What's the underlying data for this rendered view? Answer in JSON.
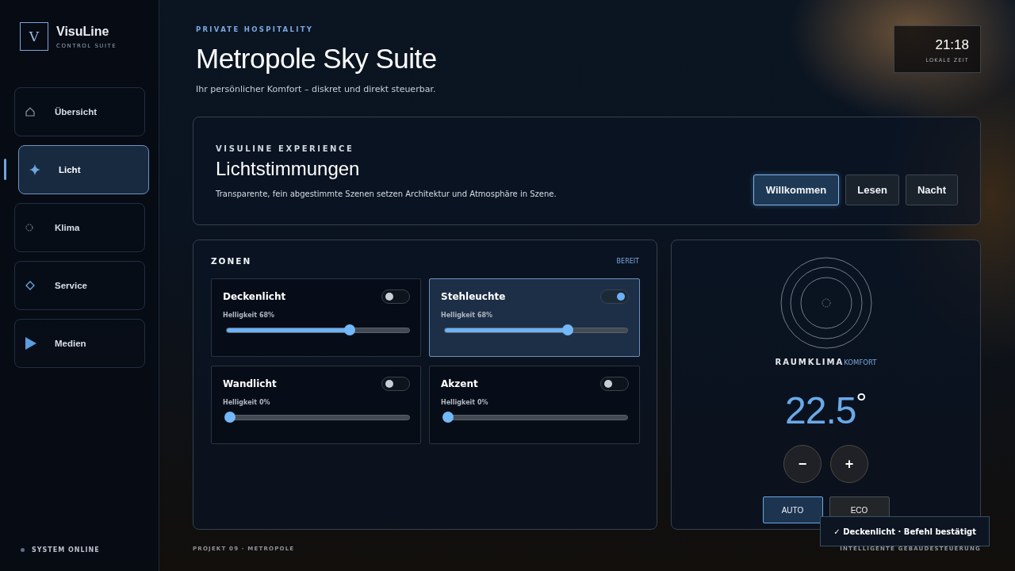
{
  "brand": {
    "mark": "V",
    "name": "VisuLine",
    "tagline": "CONTROL SUITE"
  },
  "sidebar": {
    "items": [
      {
        "label": "Übersicht",
        "selected": false
      },
      {
        "label": "Licht",
        "selected": true
      },
      {
        "label": "Klima",
        "selected": false
      },
      {
        "label": "Service",
        "selected": false
      },
      {
        "label": "Medien",
        "selected": false
      }
    ],
    "status": "SYSTEM ONLINE"
  },
  "header": {
    "eyebrow": "PRIVATE HOSPITALITY",
    "title": "Metropole Sky Suite",
    "subtitle": "Ihr persönlicher Komfort – diskret und direkt steuerbar."
  },
  "clock": {
    "time": "21:18",
    "label": "LOKALE ZEIT"
  },
  "scenes": {
    "eyebrow": "VISULINE EXPERIENCE",
    "title": "Lichtstimmungen",
    "description": "Transparente, fein abgestimmte Szenen setzen Architektur und Atmosphäre in Szene.",
    "buttons": [
      {
        "label": "Willkommen",
        "selected": true
      },
      {
        "label": "Lesen",
        "selected": false
      },
      {
        "label": "Nacht",
        "selected": false
      }
    ]
  },
  "zones": {
    "title": "ZONEN",
    "status": "BEREIT",
    "items": [
      {
        "name": "Deckenlicht",
        "on": false,
        "selected": false,
        "reading": "Helligkeit 68%",
        "level": 0.68
      },
      {
        "name": "Stehleuchte",
        "on": true,
        "selected": true,
        "reading": "Helligkeit 68%",
        "level": 0.68
      },
      {
        "name": "Wandlicht",
        "on": false,
        "selected": false,
        "reading": "Helligkeit 0%",
        "level": 0
      },
      {
        "name": "Akzent",
        "on": false,
        "selected": false,
        "reading": "Helligkeit 0%",
        "level": 0
      }
    ]
  },
  "climate": {
    "title": "RAUMKLIMA",
    "status": "KOMFORT",
    "temperature": "22.5",
    "unit": "°",
    "decrease": "−",
    "increase": "+",
    "modes": [
      {
        "label": "AUTO",
        "selected": true
      },
      {
        "label": "ECO",
        "selected": false
      }
    ]
  },
  "footer": {
    "left": "PROJEKT 09 · METROPOLE",
    "right": "INTELLIGENTE GEBÄUDESTEUERUNG"
  },
  "toast": {
    "text": "✓ Deckenlicht · Befehl bestätigt"
  }
}
